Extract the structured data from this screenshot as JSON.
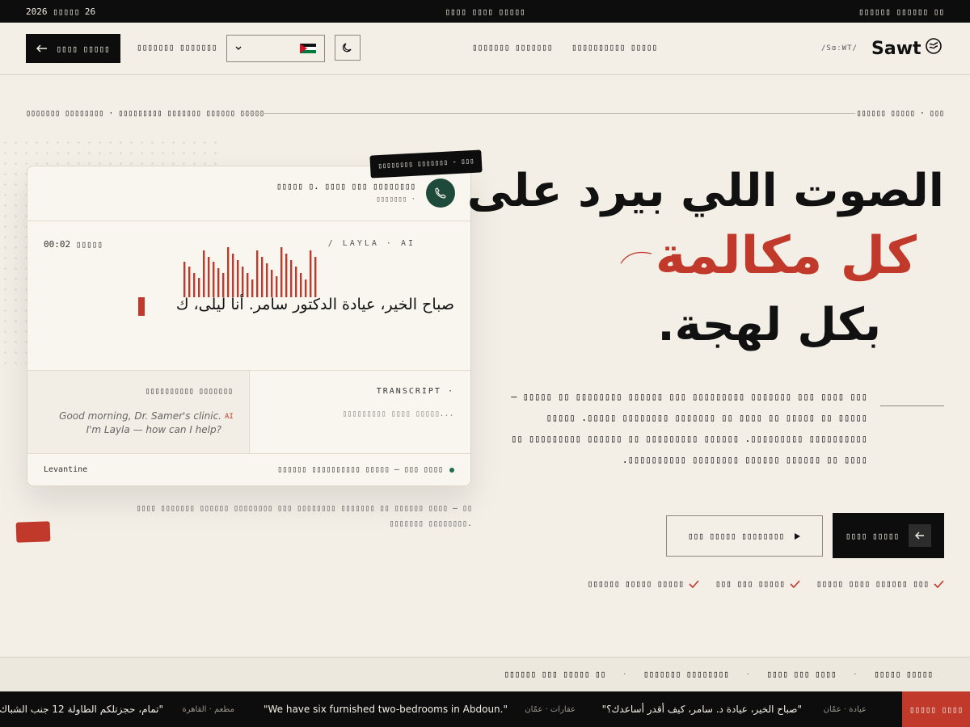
{
  "topbar": {
    "date": "2026 ▯▯▯▯▯ 26",
    "center": "▯▯▯▯ ▯▯▯▯ ▯▯▯▯▯",
    "right": "▯▯▯▯▯▯ ▯▯▯▯▯▯ ▯▯"
  },
  "header": {
    "cta": "▯▯▯▯ ▯▯▯▯▯",
    "login": "▯▯▯▯▯▯▯ ▯▯▯▯▯▯▯",
    "nav": [
      "▯▯▯▯▯▯▯ ▯▯▯▯▯▯▯",
      "▯▯▯▯▯▯▯▯▯▯ ▯▯▯▯▯"
    ],
    "logo": "Sawt",
    "phonetic": "/SɑːWT/"
  },
  "breadcrumb": {
    "left": "▯▯▯▯▯▯▯ ▯▯▯▯▯▯▯▯ · ▯▯▯▯▯▯▯▯▯ ▯▯▯▯▯▯▯ ▯▯▯▯▯▯ ▯▯▯▯▯",
    "right": "▯▯▯▯▯▯ ▯▯▯▯▯ · ▯▯▯"
  },
  "call_card": {
    "tag": "▯▯▯▯▯▯▯▯ ▯▯▯▯▯▯▯ - ▯▯▯",
    "title": "▯▯▯▯▯ ▯. ▯▯▯▯ ▯▯▯ ▯▯▯▯▯▯▯▯",
    "subtitle": "▯▯▯▯▯▯▯ ·",
    "timer": "00:02 ▯▯▯▯▯",
    "speaker": "/   LAYLA · AI",
    "spoken_text": "صباح الخير، عيادة الدكتور سامر. أنا ليلى، ك",
    "transcript_label": "TRANSCRIPT ·",
    "transcript_ar": "▯▯▯▯▯▯▯▯▯ ▯▯▯▯ ▯▯▯▯▯...",
    "translation_label": "▯▯▯▯▯▯▯▯▯▯ ▯▯▯▯▯▯▯",
    "translation_en": "Good morning, Dr. Samer's clinic. I'm Layla — how can I help?",
    "ai_badge": "AI",
    "dialect": "Levantine",
    "status": "▯▯▯▯▯▯ ▯▯▯▯▯▯▯▯▯▯ ▯▯▯▯▯ — ▯▯▯ ▯▯▯▯"
  },
  "caption": "▯▯▯▯ ▯▯▯▯▯▯▯ ▯▯▯▯▯▯ ▯▯▯▯▯▯▯▯ ▯▯▯ ▯▯▯▯▯▯▯▯ ▯▯▯▯▯▯▯ ▯▯ ▯▯▯▯▯▯ ▯▯▯▯ — ▯▯ ▯▯▯▯▯▯▯ ▯▯▯▯▯▯▯▯.",
  "hero": {
    "line1": "الصوت اللي بيرد على",
    "line2": "كل مكالمة",
    "line3": "بكل لهجة.",
    "intro": "▯▯▯ ▯▯▯▯ ▯▯▯ ▯▯▯▯▯▯▯ ▯▯▯▯▯▯▯▯▯ ▯▯▯ ▯▯▯▯▯▯ ▯▯▯▯▯▯▯▯ ▯▯ ▯▯▯▯▯ — ▯▯▯▯▯ ▯▯ ▯▯▯▯▯ ▯▯ ▯▯▯▯ ▯▯ ▯▯▯▯▯▯▯ ▯▯▯▯▯▯▯▯ ▯▯▯▯▯. ▯▯▯▯▯ ▯▯▯▯▯▯▯▯▯▯ ▯▯▯▯▯▯▯▯▯. ▯▯▯▯▯▯ ▯▯▯▯▯▯▯▯▯ ▯▯ ▯▯▯▯▯▯ ▯▯▯▯▯▯▯▯▯ ▯▯ ▯▯▯▯ ▯▯ ▯▯▯▯▯▯ ▯▯▯▯▯▯ ▯▯▯▯▯▯▯▯ ▯▯▯▯▯▯▯▯▯▯.",
    "cta_primary": "▯▯▯▯ ▯▯▯▯▯",
    "cta_secondary": "▯▯▯ ▯▯▯▯▯ ▯▯▯▯▯▯▯▯",
    "checks": [
      "▯▯▯ ▯▯▯▯▯▯ ▯▯▯▯ ▯▯▯▯▯",
      "▯▯▯▯▯ ▯▯▯ ▯▯▯",
      "▯▯▯▯▯ ▯▯▯▯▯ ▯▯▯▯▯▯"
    ]
  },
  "strip": [
    "▯▯▯▯▯ ▯▯▯▯▯",
    "▯▯▯▯ ▯▯▯ ▯▯▯▯",
    "▯▯▯▯▯▯▯▯ ▯▯▯▯▯▯▯",
    "▯▯ ▯▯▯▯▯ ▯▯▯ ▯▯▯▯▯▯"
  ],
  "ticker": {
    "live": "▯▯▯▯▯ ▯▯▯▯",
    "items": [
      {
        "meta": "عيادة · عمّان",
        "quote": "\"صباح الخير، عيادة د. سامر، كيف أقدر أساعدك؟\""
      },
      {
        "meta": "عقارات · عمّان",
        "quote": "\"We have six furnished two-bedrooms in Abdoun.\""
      },
      {
        "meta": "مطعم · القاهرة",
        "quote": "\"تمام، حجزتلكم الطاولة 12 جنب الشباك\""
      }
    ]
  },
  "colors": {
    "accent": "#c0392b",
    "ink": "#0d0d0d",
    "paper": "#f3efe7",
    "green": "#1e4a3b"
  }
}
